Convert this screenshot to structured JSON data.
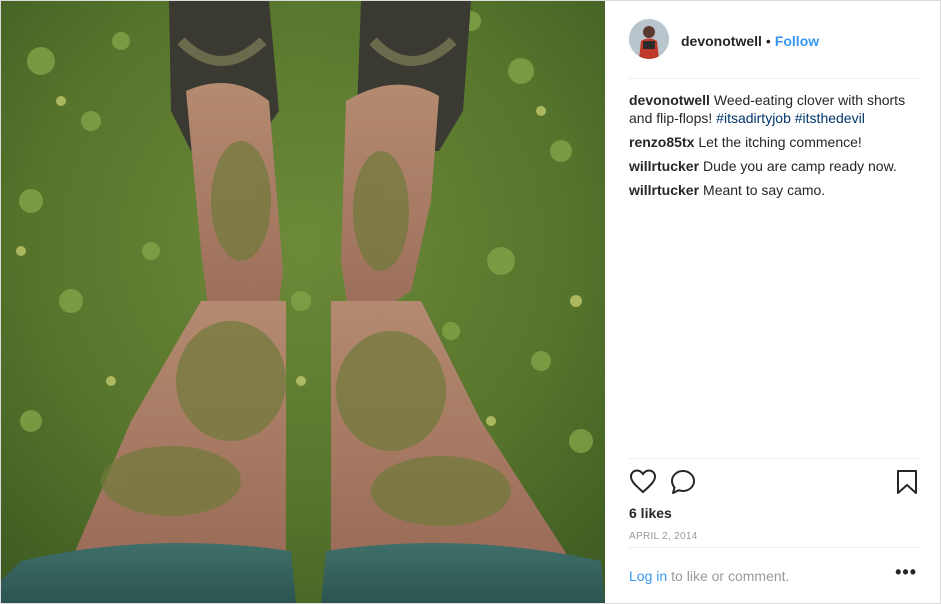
{
  "post": {
    "username": "devonotwell",
    "separator": "•",
    "follow_label": "Follow",
    "caption": {
      "user": "devonotwell",
      "text": "Weed-eating clover with shorts and flip-flops!",
      "tags": [
        "#itsadirtyjob",
        "#itsthedevil"
      ]
    },
    "comments": [
      {
        "user": "renzo85tx",
        "text": "Let the itching commence!"
      },
      {
        "user": "willrtucker",
        "text": "Dude you are camp ready now."
      },
      {
        "user": "willrtucker",
        "text": "Meant to say camo."
      }
    ],
    "likes": "6 likes",
    "date": "APRIL 2, 2014",
    "login_link": "Log in",
    "login_text": "to like or comment.",
    "more_label": "•••"
  },
  "icons": {
    "like": "heart-icon",
    "comment": "comment-bubble-icon",
    "save": "bookmark-icon",
    "more": "more-options-icon"
  },
  "colors": {
    "link": "#3897f0",
    "hashtag": "#003569",
    "muted": "#999999",
    "text": "#262626"
  }
}
